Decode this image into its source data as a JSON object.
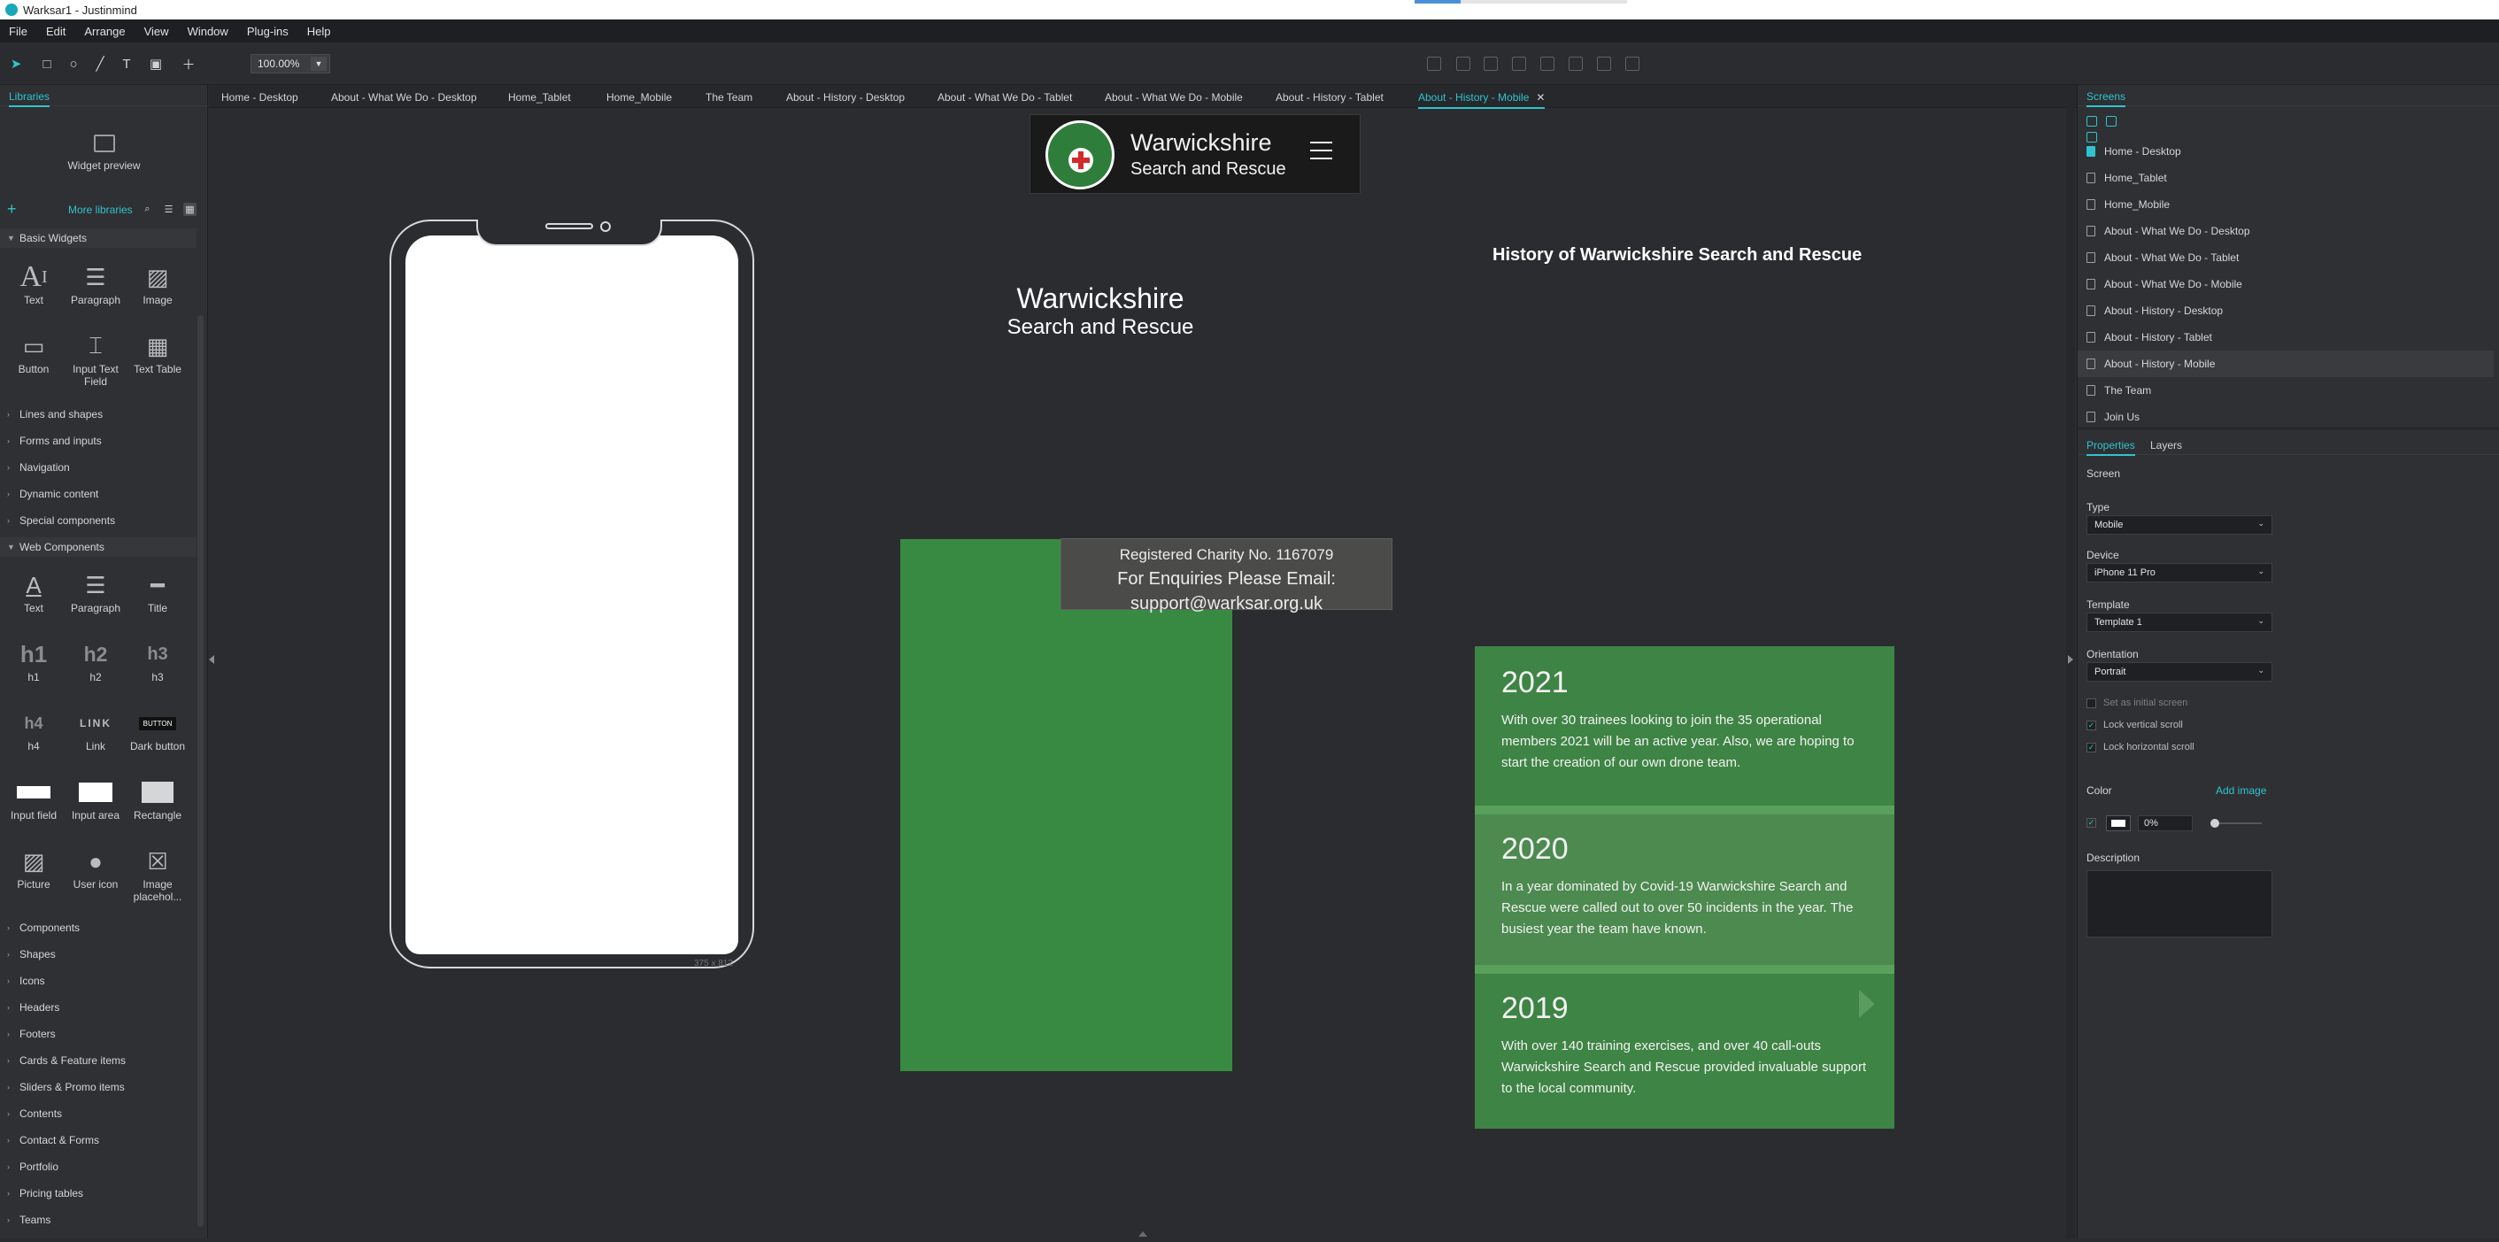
{
  "window": {
    "title": "Warksar1 - Justinmind"
  },
  "menu": [
    "File",
    "Edit",
    "Arrange",
    "View",
    "Window",
    "Plug-ins",
    "Help"
  ],
  "toolbar": {
    "zoom": "100.00%"
  },
  "left_panel": {
    "tab": "Libraries",
    "widget_preview": "Widget preview",
    "more_libraries": "More libraries",
    "basic_section": "Basic Widgets",
    "basic_widgets": [
      "Text",
      "Paragraph",
      "Image",
      "Button",
      "Input Text Field",
      "Text Table"
    ],
    "collapsed_sections_1": [
      "Lines and shapes",
      "Forms and inputs",
      "Navigation",
      "Dynamic content",
      "Special components"
    ],
    "web_section": "Web Components",
    "web_widgets": [
      "Text",
      "Paragraph",
      "Title",
      "h1",
      "h2",
      "h3",
      "h4",
      "Link",
      "Dark button",
      "Input field",
      "Input area",
      "Rectangle",
      "Picture",
      "User icon",
      "Image placehol..."
    ],
    "web_icon_text": {
      "h1": "h1",
      "h2": "h2",
      "h3": "h3",
      "h4": "h4",
      "link": "LINK",
      "dark_button": "BUTTON"
    },
    "collapsed_sections_2": [
      "Components",
      "Shapes",
      "Icons",
      "Headers",
      "Footers",
      "Cards & Feature items",
      "Sliders & Promo items",
      "Contents",
      "Contact & Forms",
      "Portfolio",
      "Pricing tables",
      "Teams"
    ]
  },
  "tabs": [
    "Home - Desktop",
    "About - What We Do - Desktop",
    "Home_Tablet",
    "Home_Mobile",
    "The Team",
    "About - History - Desktop",
    "About - What We Do - Tablet",
    "About - What We Do - Mobile",
    "About - History - Tablet",
    "About - History - Mobile"
  ],
  "active_tab_index": 9,
  "canvas": {
    "device_dim": "375 x 812",
    "logo": {
      "line1": "Warwickshire",
      "line2": "Search and Rescue"
    },
    "heading": {
      "line1": "Warwickshire",
      "line2": "Search and Rescue"
    },
    "history_title": "History of Warwickshire Search and Rescue",
    "charity": {
      "line1": "Registered Charity No. 1167079",
      "line2": "For Enquiries Please Email:",
      "line3": "support@warksar.org.uk"
    },
    "history_cards": [
      {
        "year": "2021",
        "text": "With over 30 trainees looking to join the 35 operational members 2021 will be an active year. Also, we are hoping to start the creation of our own drone team."
      },
      {
        "year": "2020",
        "text": "In a year dominated by Covid-19 Warwickshire Search and Rescue were called out to over 50 incidents in the year. The busiest year the team have known."
      },
      {
        "year": "2019",
        "text": "With over 140 training exercises, and over 40 call-outs Warwickshire Search and Rescue provided invaluable support to the local community."
      }
    ],
    "colors": {
      "green_block": "#388a43",
      "card_green": "#3e8444",
      "accent": "#2ec4cf"
    }
  },
  "right_panel": {
    "screens_tab": "Screens",
    "screens": [
      "Home - Desktop",
      "Home_Tablet",
      "Home_Mobile",
      "About - What We Do - Desktop",
      "About - What We Do - Tablet",
      "About - What We Do - Mobile",
      "About - History - Desktop",
      "About - History - Tablet",
      "About - History - Mobile",
      "The Team",
      "Join Us"
    ],
    "selected_screen_index": 8,
    "properties_tab": "Properties",
    "layers_tab": "Layers",
    "screen_label": "Screen",
    "type_label": "Type",
    "type_value": "Mobile",
    "device_label": "Device",
    "device_value": "iPhone 11 Pro",
    "template_label": "Template",
    "template_value": "Template 1",
    "orientation_label": "Orientation",
    "orientation_value": "Portrait",
    "set_initial": "Set as initial screen",
    "lock_vertical": "Lock vertical scroll",
    "lock_horizontal": "Lock horizontal scroll",
    "color_label": "Color",
    "add_image": "Add image",
    "color_opacity": "0%",
    "description_label": "Description"
  }
}
